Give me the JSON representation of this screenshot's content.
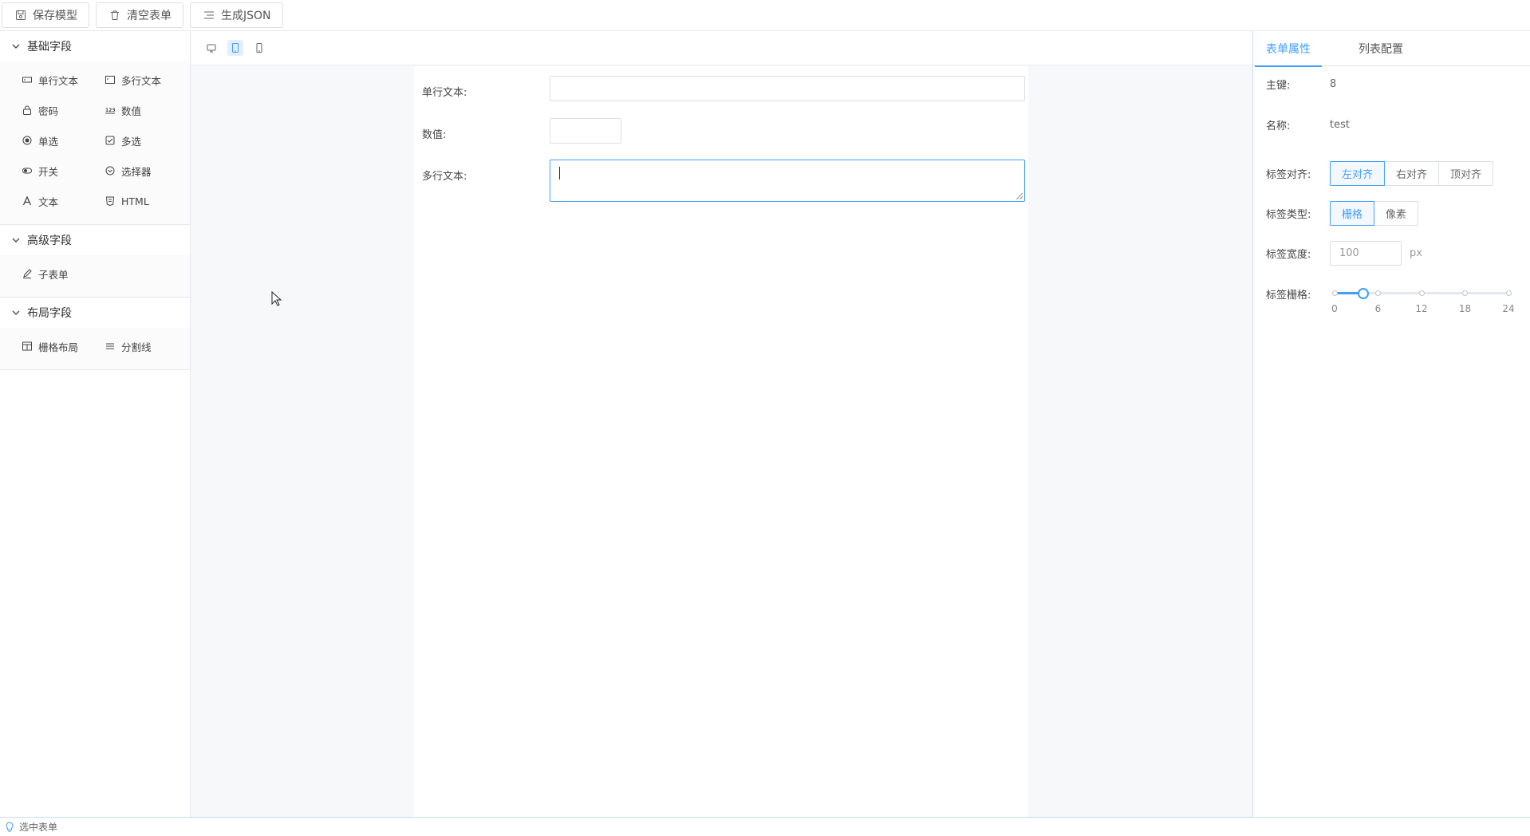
{
  "toolbar": {
    "save_label": "保存模型",
    "clear_label": "清空表单",
    "json_label": "生成JSON"
  },
  "sidebar": {
    "groups": [
      {
        "title": "基础字段",
        "items": [
          {
            "label": "单行文本",
            "icon": "input-icon"
          },
          {
            "label": "多行文本",
            "icon": "textarea-icon"
          },
          {
            "label": "密码",
            "icon": "lock-icon"
          },
          {
            "label": "数值",
            "icon": "number-icon"
          },
          {
            "label": "单选",
            "icon": "radio-icon"
          },
          {
            "label": "多选",
            "icon": "checkbox-icon"
          },
          {
            "label": "开关",
            "icon": "switch-icon"
          },
          {
            "label": "选择器",
            "icon": "select-icon"
          },
          {
            "label": "文本",
            "icon": "text-icon"
          },
          {
            "label": "HTML",
            "icon": "html-icon"
          }
        ]
      },
      {
        "title": "高级字段",
        "items": [
          {
            "label": "子表单",
            "icon": "subform-icon"
          }
        ]
      },
      {
        "title": "布局字段",
        "items": [
          {
            "label": "栅格布局",
            "icon": "grid-icon"
          },
          {
            "label": "分割线",
            "icon": "divider-icon"
          }
        ]
      }
    ]
  },
  "devices": [
    "desktop-icon",
    "tablet-icon",
    "mobile-icon"
  ],
  "active_device": "tablet-icon",
  "form": {
    "fields": [
      {
        "label": "单行文本:",
        "type": "input",
        "value": ""
      },
      {
        "label": "数值:",
        "type": "number",
        "value": ""
      },
      {
        "label": "多行文本:",
        "type": "textarea",
        "value": ""
      }
    ]
  },
  "panel": {
    "tabs": [
      "表单属性",
      "列表配置"
    ],
    "active_tab": "表单属性",
    "primary_key_label": "主键:",
    "primary_key_value": "8",
    "name_label": "名称:",
    "name_value": "test",
    "align_label": "标签对齐:",
    "align_options": [
      "左对齐",
      "右对齐",
      "顶对齐"
    ],
    "align_selected": "左对齐",
    "type_label": "标签类型:",
    "type_options": [
      "栅格",
      "像素"
    ],
    "type_selected": "栅格",
    "width_label": "标签宽度:",
    "width_value": "100",
    "width_unit": "px",
    "grid_label": "标签栅格:",
    "grid_slider": {
      "min": 0,
      "max": 24,
      "value": 4,
      "marks": [
        "0",
        "6",
        "12",
        "18",
        "24"
      ]
    }
  },
  "status": {
    "text": "选中表单"
  },
  "colors": {
    "accent": "#409eff",
    "border": "#dcdfe6"
  }
}
